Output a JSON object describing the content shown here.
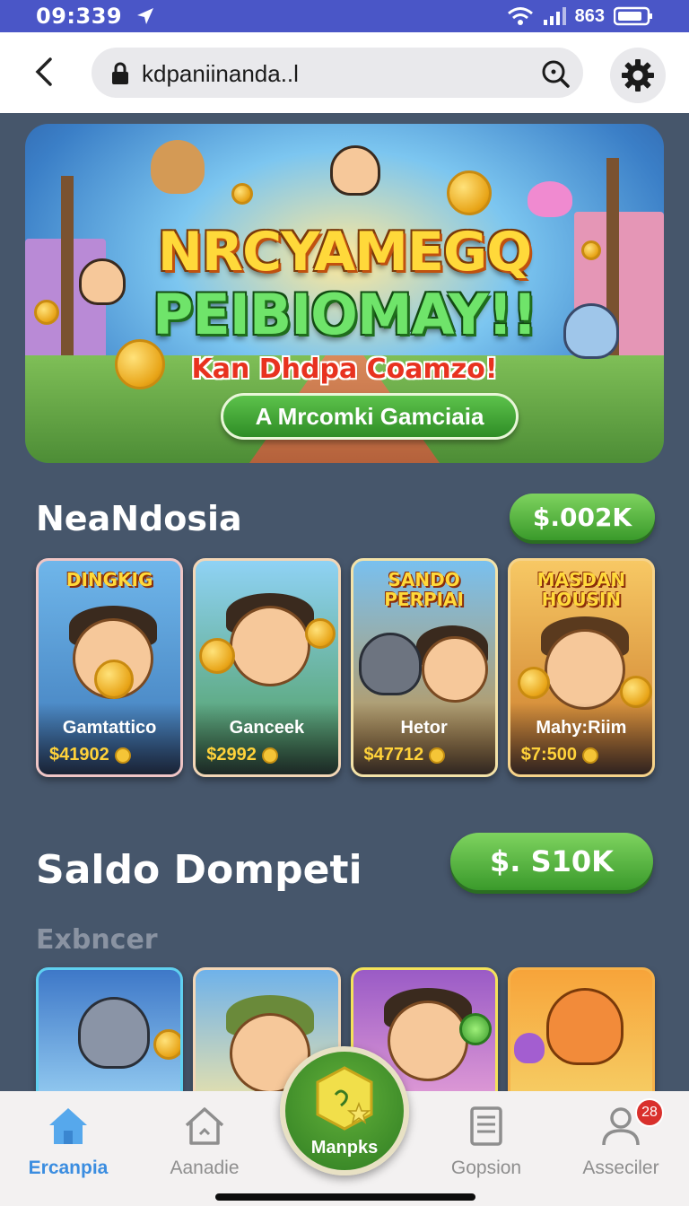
{
  "status": {
    "time": "09:339",
    "signal_text": "863"
  },
  "browser": {
    "url": "kdpaniinanda..l"
  },
  "banner": {
    "title_line1": "NRCYAMEGQ",
    "title_line2": "PEIBIOMAY!!",
    "subtitle": "Kan Dhdpa Coamzo!",
    "cta": "A Mrcomki Gamciaia"
  },
  "section1": {
    "title": "NeaNdosia",
    "button": "$.002K",
    "cards": [
      {
        "top_label": "DINGKIG",
        "name": "Gamtattico",
        "price": "$41902",
        "border": "#f0c6c6",
        "bg1": "#6fb6ea",
        "bg2": "#3d78b8"
      },
      {
        "top_label": "",
        "name": "Ganceek",
        "price": "$2992",
        "border": "#f3d6b6",
        "bg1": "#8fd2f5",
        "bg2": "#4a9a54"
      },
      {
        "top_label": "SANDO PERPIAI",
        "name": "Hetor",
        "price": "$47712",
        "border": "#f3e2a8",
        "bg1": "#79c0ef",
        "bg2": "#c98f3a"
      },
      {
        "top_label": "MASDAN HOUSIN",
        "name": "Mahy:Riim",
        "price": "$7:500",
        "border": "#f6d38a",
        "bg1": "#f7c864",
        "bg2": "#c9782a"
      }
    ]
  },
  "section2": {
    "title": "Saldo Dompeti",
    "button": "$. S10K",
    "subtitle": "Exbncer",
    "cards": [
      {
        "border": "#5fd0f0",
        "bg1": "#3e78c8",
        "bg2": "#9fd6f6"
      },
      {
        "border": "#f3d6b6",
        "bg1": "#6fb2ea",
        "bg2": "#f4e6a6"
      },
      {
        "border": "#f4e25a",
        "bg1": "#9a5bc6",
        "bg2": "#e9a3d8"
      },
      {
        "border": "#f6b24a",
        "bg1": "#f7a43a",
        "bg2": "#f6d36a"
      }
    ]
  },
  "nav": {
    "items": [
      {
        "label": "Ercanpia",
        "icon": "home-icon"
      },
      {
        "label": "Aanadie",
        "icon": "house-outline-icon"
      },
      {
        "label": "Manpks",
        "icon": "hexagon-star-icon"
      },
      {
        "label": "Gopsion",
        "icon": "receipt-icon"
      },
      {
        "label": "Asseciler",
        "icon": "user-icon"
      }
    ],
    "badge": "28"
  },
  "colors": {
    "status_bar": "#4a56c7",
    "page_bg": "#46566b",
    "accent_green": "#3a9a2b",
    "active_nav": "#3b8de0"
  }
}
